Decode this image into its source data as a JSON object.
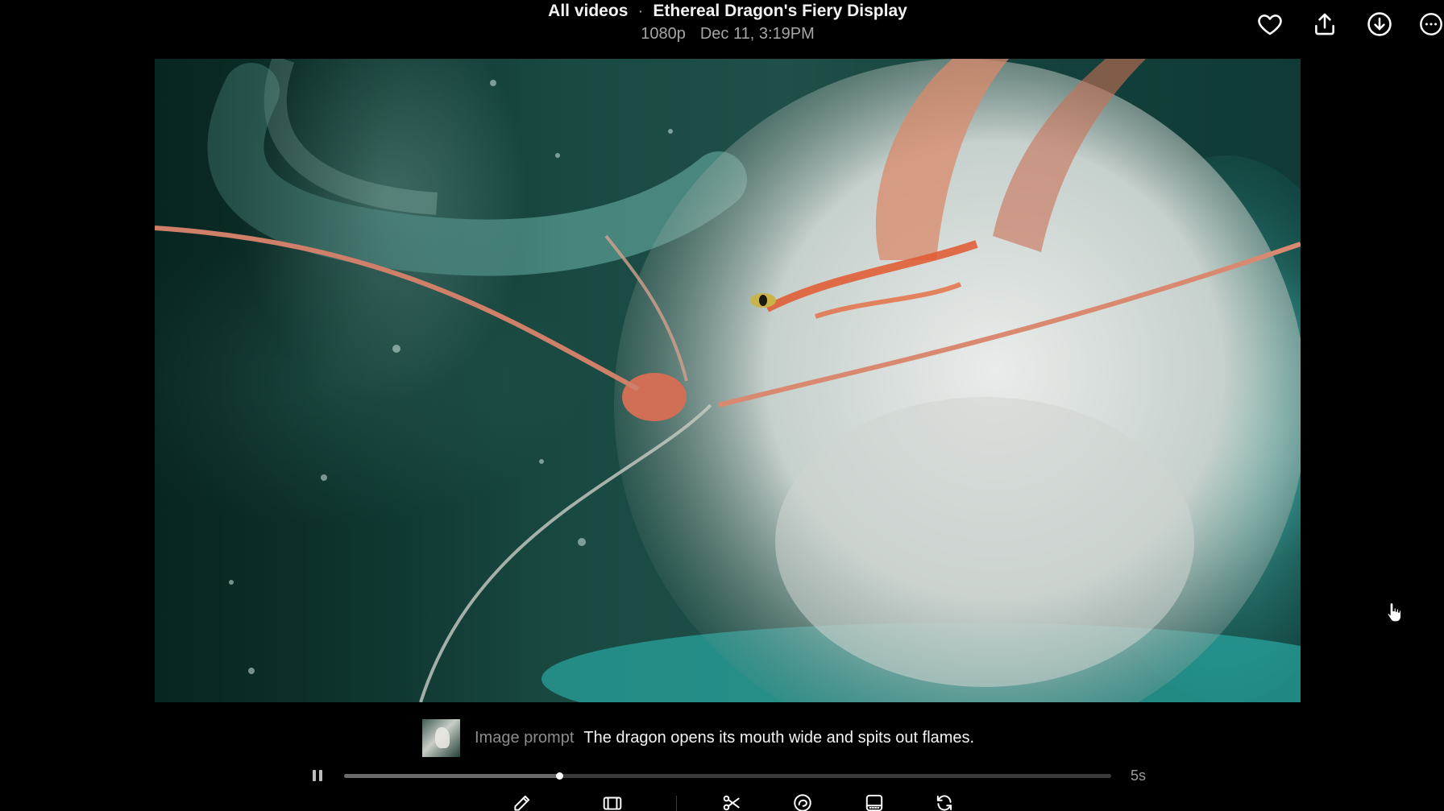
{
  "header": {
    "breadcrumb_root": "All videos",
    "separator": "·",
    "title": "Ethereal Dragon's Fiery Display",
    "resolution": "1080p",
    "timestamp": "Dec 11, 3:19PM"
  },
  "top_actions": {
    "icons": [
      "heart-icon",
      "share-icon",
      "download-icon",
      "more-icon"
    ]
  },
  "prompt": {
    "label": "Image prompt",
    "text": "The dragon opens its mouth wide and spits out flames."
  },
  "player": {
    "state": "playing",
    "progress": 0.28,
    "duration": "5s"
  },
  "toolbar": {
    "icons": [
      "edit-icon",
      "aspect-ratio-icon",
      "cut-icon",
      "loop-icon",
      "frame-icon",
      "remix-icon"
    ]
  },
  "colors": {
    "background": "#000000",
    "text_primary": "#f2f2f2",
    "text_secondary": "#a6a6a6",
    "track": "#3a3a3a"
  }
}
